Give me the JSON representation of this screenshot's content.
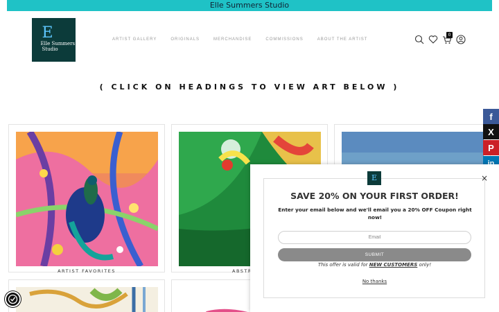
{
  "topbar": {
    "title": "Elle Summers Studio"
  },
  "logo": {
    "line1": "Elle Summers",
    "line2": "Studio"
  },
  "nav": {
    "items": [
      {
        "label": "ARTIST GALLERY"
      },
      {
        "label": "ORIGINALS"
      },
      {
        "label": "MERCHANDISE"
      },
      {
        "label": "COMMISSIONS"
      },
      {
        "label": "ABOUT THE ARTIST"
      }
    ]
  },
  "header_icons": {
    "cart_count": "0"
  },
  "heading": "( CLICK ON HEADINGS TO VIEW ART BELOW )",
  "cards": [
    {
      "caption": "ARTIST FAVORITES"
    },
    {
      "caption": "ABSTR"
    },
    {
      "caption": ""
    }
  ],
  "share": {
    "facebook": "f",
    "x": "X",
    "pinterest": "P",
    "linkedin": "in"
  },
  "popup": {
    "close": "×",
    "logo_letter": "E",
    "title": "SAVE 20% ON YOUR FIRST ORDER!",
    "description": "Enter your email below and we'll email you a 20% OFF Coupon right now!",
    "email_placeholder": "Email",
    "submit_label": "SUBMIT",
    "offer_prefix": "This offer is valid for ",
    "offer_highlight": "NEW CUSTOMERS",
    "offer_suffix": " only!",
    "no_thanks": "No thanks"
  },
  "colors": {
    "topbar": "#1fc2c6",
    "logo_bg": "#0c3b3a",
    "submit_bg": "#8a8a8a",
    "facebook": "#3b5998",
    "pinterest": "#cb2027",
    "linkedin": "#0077b5"
  }
}
